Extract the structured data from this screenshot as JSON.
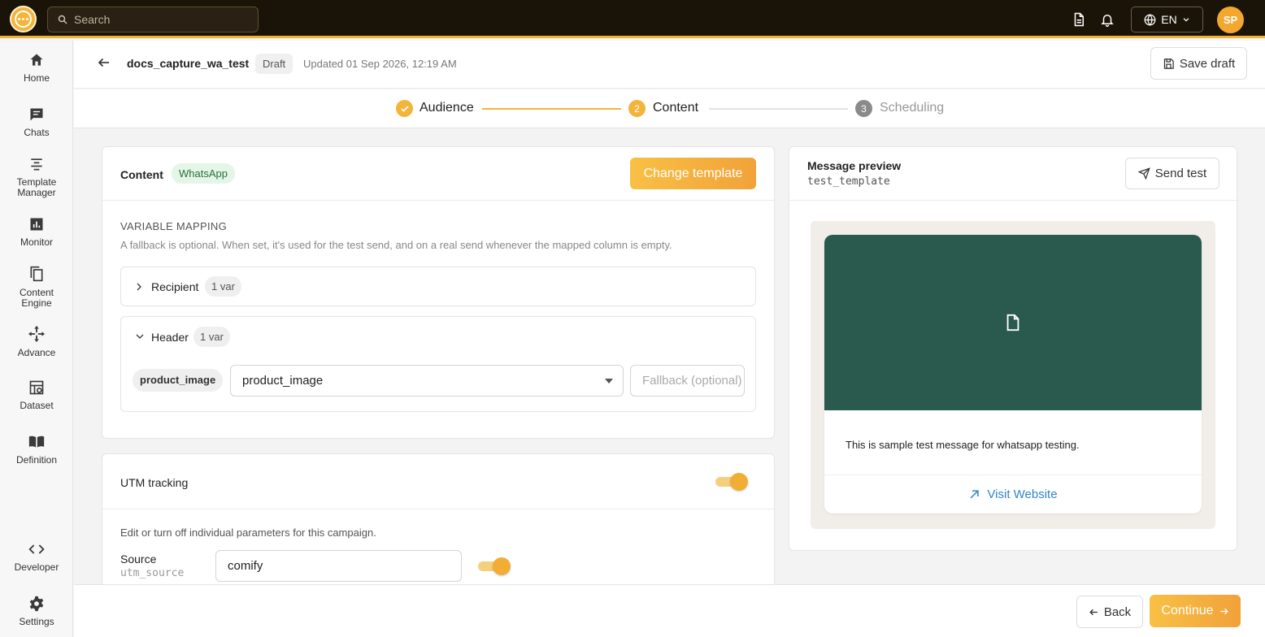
{
  "topbar": {
    "search_placeholder": "Search",
    "language": "EN",
    "avatar_initials": "SP"
  },
  "sidebar": {
    "items": [
      {
        "label": "Home",
        "icon": "home-icon"
      },
      {
        "label": "Chats",
        "icon": "chat-icon"
      },
      {
        "label": "Template Manager",
        "icon": "template-icon"
      },
      {
        "label": "Monitor",
        "icon": "monitor-chart-icon"
      },
      {
        "label": "Content Engine",
        "icon": "copy-icon"
      },
      {
        "label": "Advance",
        "icon": "move-icon"
      },
      {
        "label": "Dataset",
        "icon": "dataset-icon"
      },
      {
        "label": "Definition",
        "icon": "book-icon"
      },
      {
        "label": "Developer",
        "icon": "code-icon"
      },
      {
        "label": "Settings",
        "icon": "gear-icon"
      }
    ]
  },
  "header": {
    "campaign_name": "docs_capture_wa_test",
    "status": "Draft",
    "updated": "Updated 01 Sep 2026, 12:19 AM",
    "save_label": "Save draft"
  },
  "stepper": {
    "steps": [
      {
        "label": "Audience",
        "state": "done"
      },
      {
        "label": "Content",
        "number": "2",
        "state": "active"
      },
      {
        "label": "Scheduling",
        "number": "3",
        "state": "upcoming"
      }
    ]
  },
  "content": {
    "title": "Content",
    "channel": "WhatsApp",
    "change_template_label": "Change template",
    "variable_mapping_title": "VARIABLE MAPPING",
    "variable_mapping_help": "A fallback is optional. When set, it's used for the test send, and on a real send whenever the mapped column is empty.",
    "groups": [
      {
        "title": "Recipient",
        "count": "1 var",
        "expanded": false
      },
      {
        "title": "Header",
        "count": "1 var",
        "expanded": true,
        "variable": "product_image",
        "mapped_column": "product_image",
        "fallback_placeholder": "Fallback (optional)"
      }
    ]
  },
  "utm": {
    "title": "UTM tracking",
    "enabled": true,
    "help": "Edit or turn off individual parameters for this campaign.",
    "params": [
      {
        "label": "Source",
        "key": "utm_source",
        "value": "comify",
        "enabled": true
      }
    ]
  },
  "preview": {
    "title": "Message preview",
    "template_name": "test_template",
    "send_test_label": "Send test",
    "body": "This is sample test message for whatsapp testing.",
    "cta_label": "Visit Website"
  },
  "footer": {
    "back_label": "Back",
    "continue_label": "Continue"
  },
  "colors": {
    "accent": "#f1a23a",
    "topbar": "#1a1308",
    "media": "#2a5a4e",
    "link": "#2f86c8"
  }
}
